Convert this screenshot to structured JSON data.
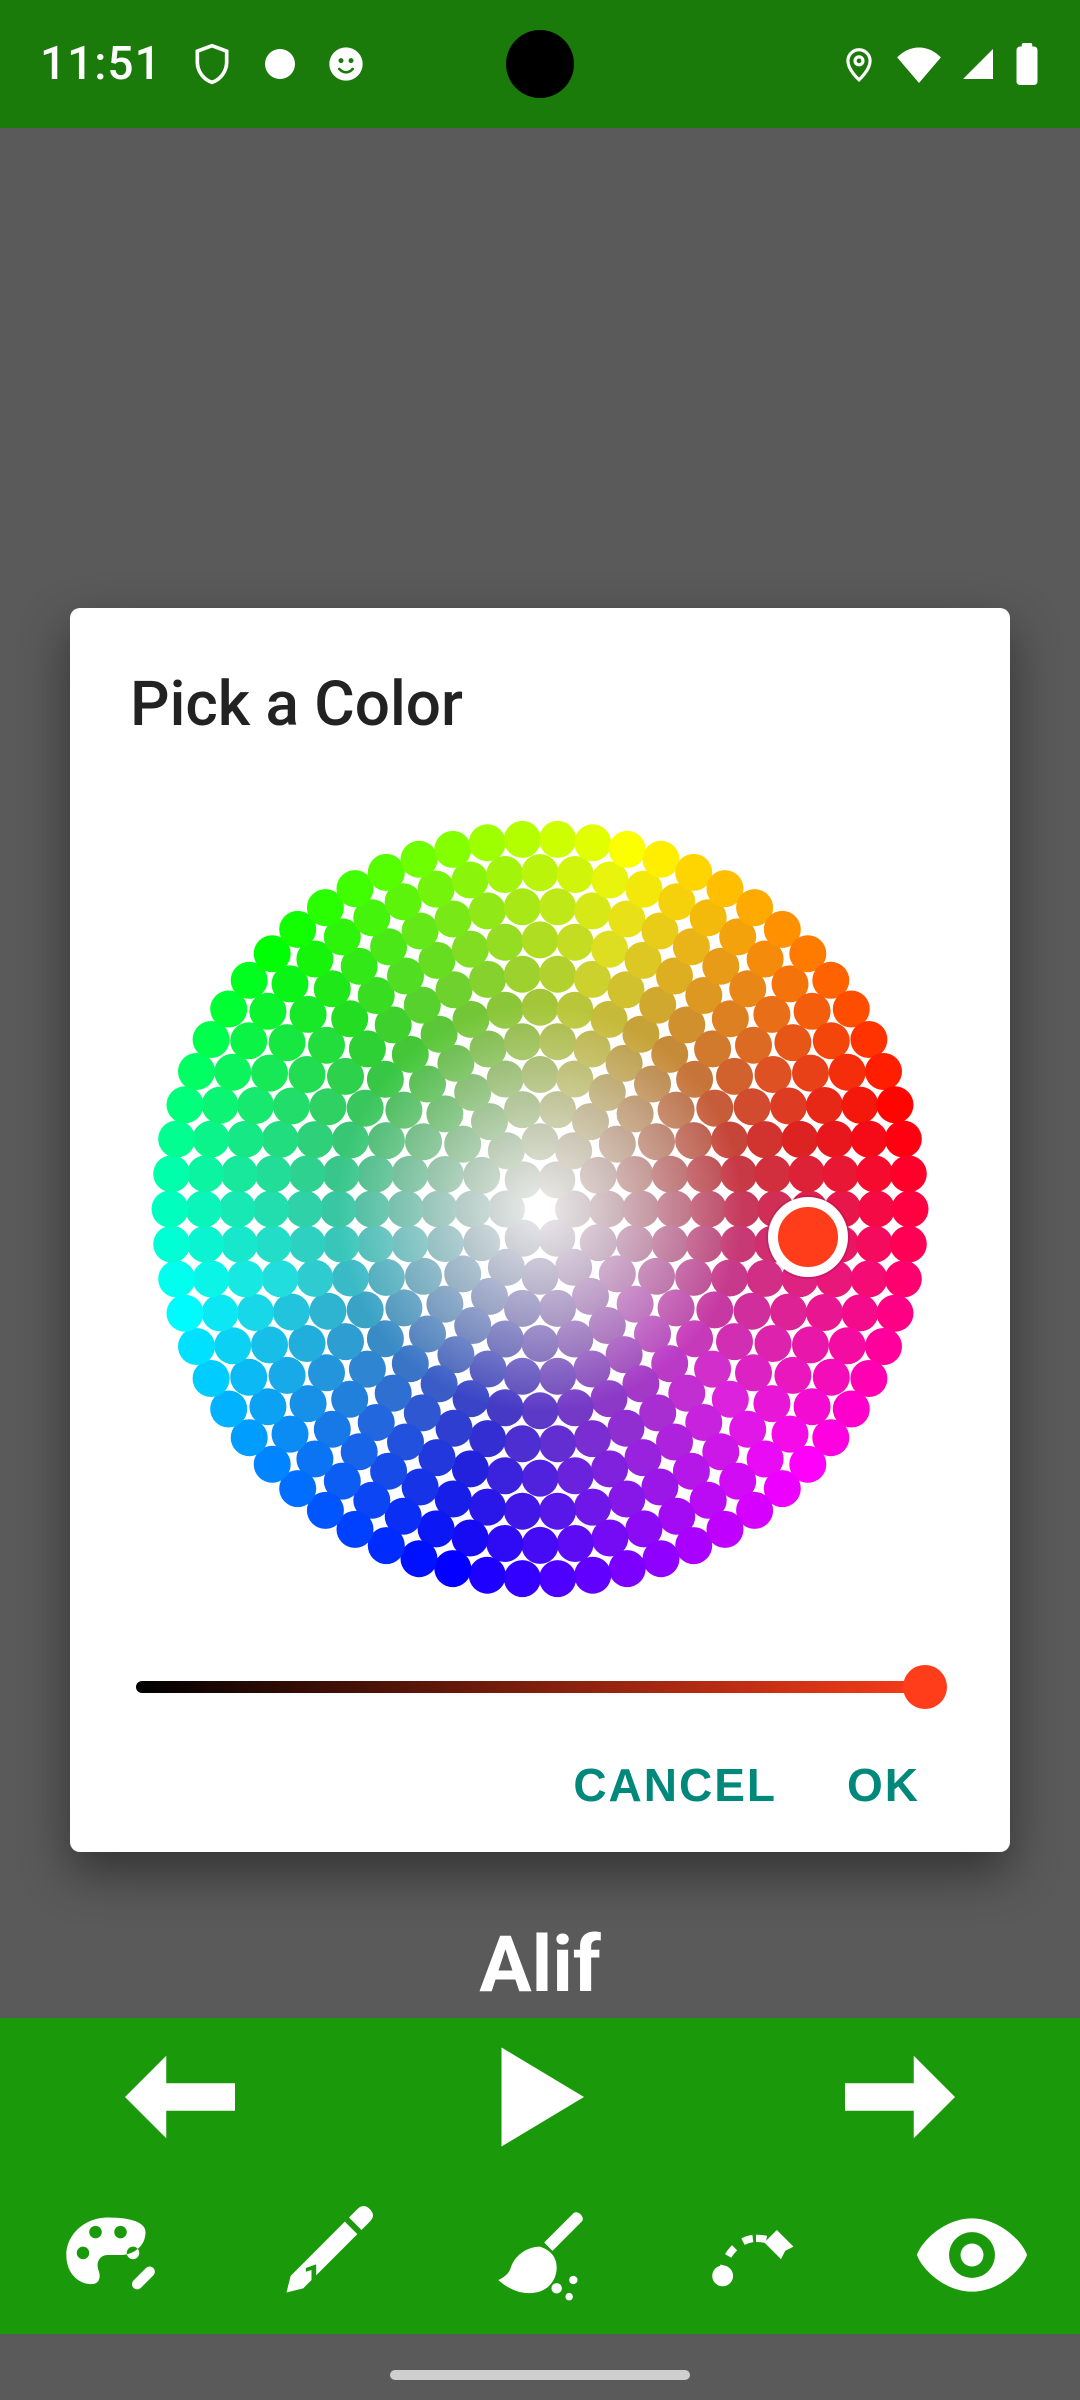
{
  "status_bar": {
    "time": "11:51"
  },
  "dialog": {
    "title": "Pick a Color",
    "selected_color": "#ff3d1a",
    "brightness_value": 0.97,
    "cancel_label": "CANCEL",
    "ok_label": "OK"
  },
  "background": {
    "title": "Alif"
  },
  "colors": {
    "accent": "#00897b",
    "toolbar_bg": "#1a9a0a",
    "statusbar_bg": "#1a7a0a"
  }
}
